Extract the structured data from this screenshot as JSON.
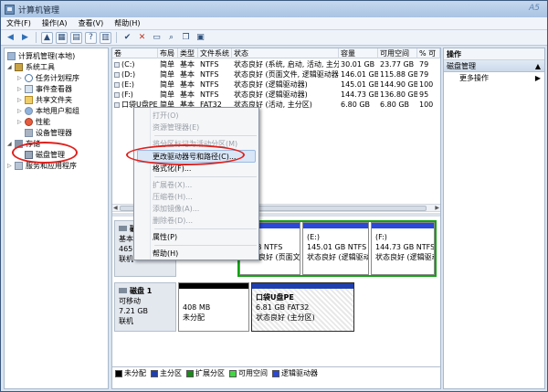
{
  "window": {
    "title": "计算机管理",
    "watermark": "A5"
  },
  "menu": [
    "文件(F)",
    "操作(A)",
    "查看(V)",
    "帮助(H)"
  ],
  "tree": {
    "root": "计算机管理(本地)",
    "system_tools": "系统工具",
    "task_scheduler": "任务计划程序",
    "event_viewer": "事件查看器",
    "shared_folders": "共享文件夹",
    "local_users": "本地用户和组",
    "performance": "性能",
    "device_manager": "设备管理器",
    "storage": "存储",
    "disk_management": "磁盘管理",
    "services": "服务和应用程序"
  },
  "volume_table": {
    "columns": [
      "卷",
      "布局",
      "类型",
      "文件系统",
      "状态",
      "容量",
      "可用空间",
      "% 可"
    ],
    "rows": [
      [
        "(C:)",
        "简单",
        "基本",
        "NTFS",
        "状态良好 (系统, 启动, 活动, 主分区)",
        "30.01 GB",
        "23.77 GB",
        "79"
      ],
      [
        "(D:)",
        "简单",
        "基本",
        "NTFS",
        "状态良好 (页面文件, 逻辑驱动器)",
        "146.01 GB",
        "115.88 GB",
        "79"
      ],
      [
        "(E:)",
        "简单",
        "基本",
        "NTFS",
        "状态良好 (逻辑驱动器)",
        "145.01 GB",
        "144.90 GB",
        "100"
      ],
      [
        "(F:)",
        "简单",
        "基本",
        "NTFS",
        "状态良好 (逻辑驱动器)",
        "144.73 GB",
        "136.80 GB",
        "95"
      ],
      [
        "口袋U盘PE",
        "简单",
        "基本",
        "FAT32",
        "状态良好 (活动, 主分区)",
        "6.80 GB",
        "6.80 GB",
        "100"
      ]
    ]
  },
  "disk0": {
    "name": "磁",
    "type": "基本",
    "size": "465.7",
    "state": "联机",
    "part_d_size": "1 GB NTFS",
    "part_d_status": "状态良好 (页面文件",
    "part_e_label": "(E:)",
    "part_e_size": "145.01 GB NTFS",
    "part_e_status": "状态良好 (逻辑驱动",
    "part_f_label": "(F:)",
    "part_f_size": "144.73 GB NTFS",
    "part_f_status": "状态良好 (逻辑驱动"
  },
  "disk1": {
    "name": "磁盘 1",
    "type": "可移动",
    "size": "7.21 GB",
    "state": "联机",
    "unalloc_size": "408 MB",
    "unalloc_label": "未分配",
    "pe_label": "口袋U盘PE",
    "pe_size": "6.81 GB FAT32",
    "pe_status": "状态良好 (主分区)"
  },
  "legend": [
    {
      "label": "未分配",
      "color": "#000000"
    },
    {
      "label": "主分区",
      "color": "#1f3fae"
    },
    {
      "label": "扩展分区",
      "color": "#1a8a1a"
    },
    {
      "label": "可用空间",
      "color": "#42d642"
    },
    {
      "label": "逻辑驱动器",
      "color": "#2b48d8"
    }
  ],
  "actions": {
    "header": "操作",
    "section": "磁盘管理",
    "more": "更多操作"
  },
  "context_menu": {
    "open": "打开(O)",
    "explore": "资源管理器(E)",
    "mark_active": "将分区标记为活动分区(M)",
    "change_letter": "更改驱动器号和路径(C)...",
    "format": "格式化(F)...",
    "extend": "扩展卷(X)...",
    "shrink": "压缩卷(H)...",
    "add_mirror": "添加镜像(A)...",
    "delete": "删除卷(D)...",
    "properties": "属性(P)",
    "help": "帮助(H)"
  }
}
